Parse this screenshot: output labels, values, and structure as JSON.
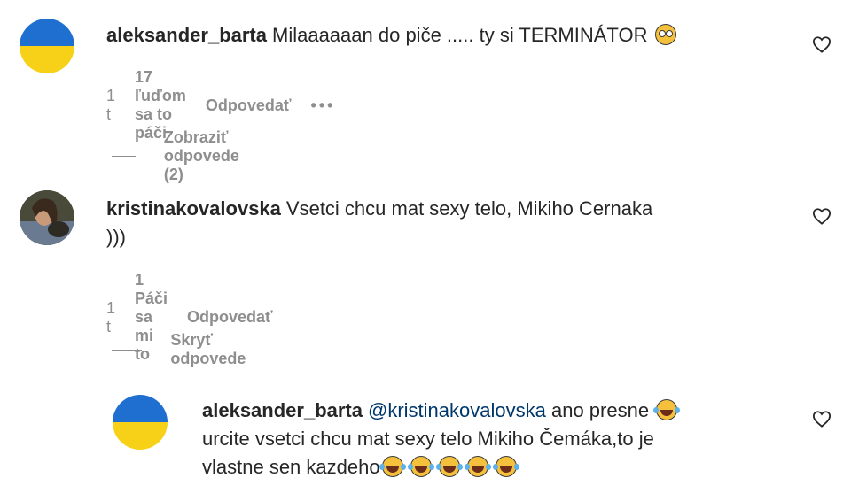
{
  "comments": [
    {
      "avatar": "ukraine-flag",
      "username": "aleksander_barta",
      "text": "Milaaaaaan do piče ..... ty si TERMINÁTOR",
      "emoji": "flushed-face",
      "time": "1 t",
      "likes": "17 ľuďom sa to páči",
      "reply": "Odpovedať",
      "more": "•••",
      "replies_toggle": "Zobraziť odpovede (2)"
    },
    {
      "avatar": "user-photo",
      "username": "kristinakovalovska",
      "text_line1": "Vsetci chcu mat sexy telo, Mikiho Cernaka",
      "text_line2": ")))",
      "time": "1 t",
      "likes": "1 Páči sa mi to",
      "reply": "Odpovedať",
      "replies_toggle": "Skryť odpovede"
    },
    {
      "avatar": "ukraine-flag",
      "username": "aleksander_barta",
      "mention": "@kristinakovalovska",
      "text_line1": "ano presne",
      "text_line2": "urcite vsetci chcu mat sexy telo Mikiho Čemáka,to je",
      "text_line3": "vlastne sen kazdeho",
      "emoji": "tears-of-joy"
    }
  ],
  "colors": {
    "flag_blue": "#1f6fd1",
    "flag_yellow": "#f7d117",
    "text": "#262626",
    "secondary": "#8e8e8e",
    "mention": "#00376b"
  },
  "icons": [
    "heart-outline-icon",
    "flushed-face-emoji",
    "tears-of-joy-emoji",
    "more-dots-icon"
  ]
}
